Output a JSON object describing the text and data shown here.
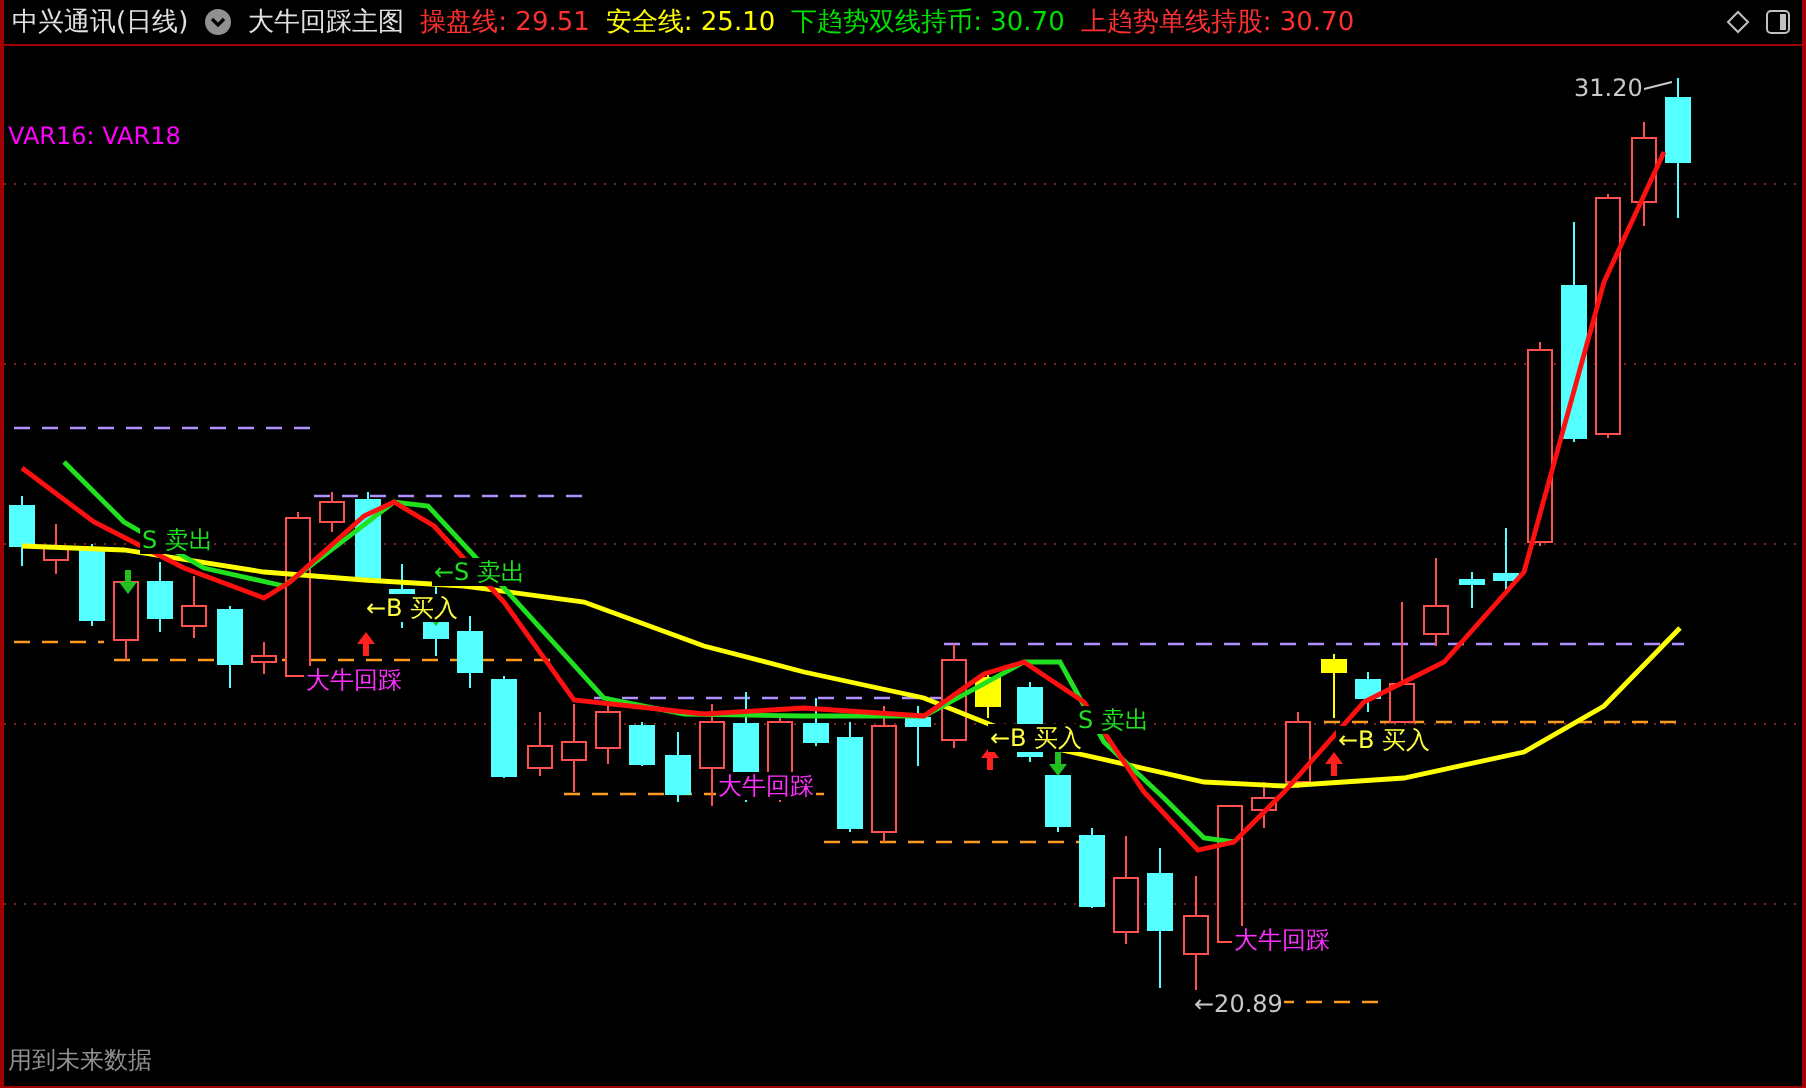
{
  "header": {
    "security": "中兴通讯(日线)",
    "indicator": "大牛回踩主图",
    "readings": [
      {
        "text": "操盘线: 29.51",
        "color": "#ff3030"
      },
      {
        "text": "安全线: 25.10",
        "color": "#ffff00"
      },
      {
        "text": "下趋势双线持币: 30.70",
        "color": "#00e000"
      },
      {
        "text": "上趋势单线持股: 30.70",
        "color": "#ff3030"
      }
    ]
  },
  "chart": {
    "legend": "VAR16: VAR18",
    "annotations": [
      {
        "kind": "sell",
        "text": "S 卖出"
      },
      {
        "kind": "buy",
        "text": "←B 买入"
      },
      {
        "kind": "sell",
        "text": "←S 卖出"
      },
      {
        "kind": "pullback",
        "text": "大牛回踩"
      },
      {
        "kind": "pullback",
        "text": "大牛回踩"
      },
      {
        "kind": "buy",
        "text": "←B 买入"
      },
      {
        "kind": "sell",
        "text": "S 卖出"
      },
      {
        "kind": "buy",
        "text": "←B 买入"
      },
      {
        "kind": "pullback",
        "text": "大牛回踩"
      },
      {
        "kind": "price",
        "text": "31.20"
      },
      {
        "kind": "price",
        "text": "←20.89"
      }
    ]
  },
  "footer": {
    "note": "用到未来数据"
  }
}
